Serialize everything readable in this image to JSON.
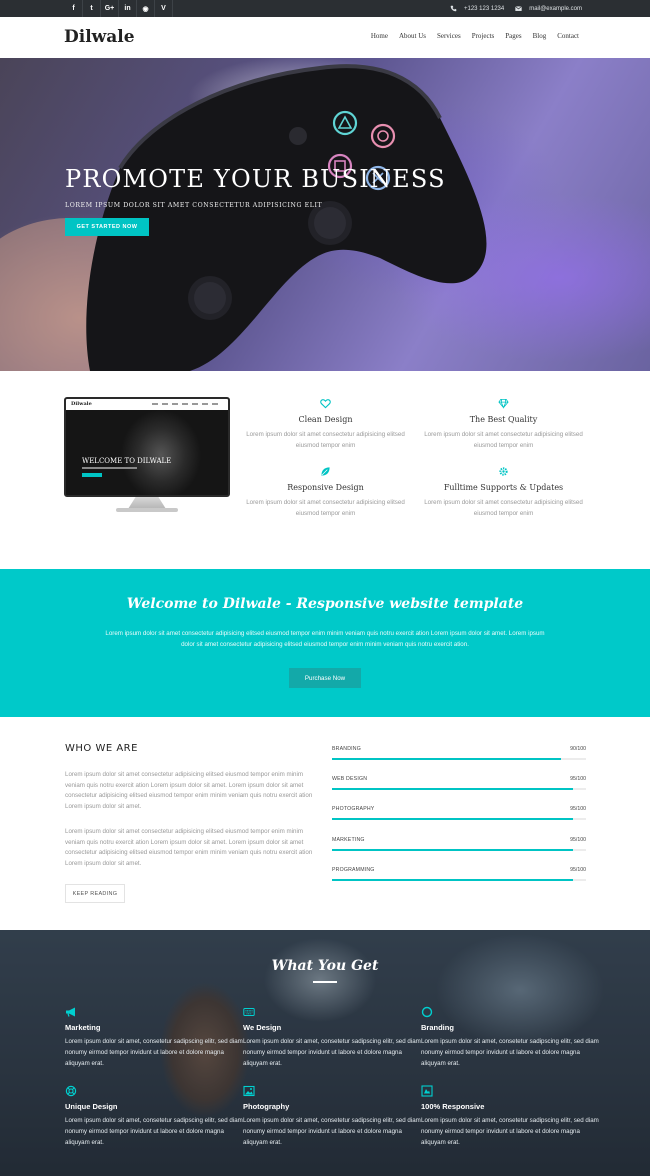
{
  "topbar": {
    "social": [
      {
        "icon": "facebook-icon",
        "glyph": "f"
      },
      {
        "icon": "twitter-icon",
        "glyph": "t"
      },
      {
        "icon": "google-plus-icon",
        "glyph": "G+"
      },
      {
        "icon": "linkedin-icon",
        "glyph": "in"
      },
      {
        "icon": "dribbble-icon",
        "glyph": "◉"
      },
      {
        "icon": "vimeo-icon",
        "glyph": "V"
      }
    ],
    "phone": "+123 123 1234",
    "email": "mail@example.com"
  },
  "nav": {
    "logo": "Dilwale",
    "items": [
      "Home",
      "About Us",
      "Services",
      "Projects",
      "Pages",
      "Blog",
      "Contact"
    ]
  },
  "hero": {
    "title": "PROMOTE YOUR BUSINESS",
    "subtitle": "LOREM IPSUM DOLOR SIT AMET CONSECTETUR ADIPISICING ELIT",
    "button": "GET STARTED NOW"
  },
  "monitor": {
    "logo": "Dilwale",
    "title": "WELCOME TO DILWALE"
  },
  "features": [
    {
      "icon": "heart-icon",
      "title": "Clean Design",
      "text": "Lorem ipsum dolor sit amet consectetur adipisicing elitsed eiusmod tempor enim"
    },
    {
      "icon": "diamond-icon",
      "title": "The Best Quality",
      "text": "Lorem ipsum dolor sit amet consectetur adipisicing elitsed eiusmod tempor enim"
    },
    {
      "icon": "leaf-icon",
      "title": "Responsive Design",
      "text": "Lorem ipsum dolor sit amet consectetur adipisicing elitsed eiusmod tempor enim"
    },
    {
      "icon": "gear-icon",
      "title": "Fulltime Supports & Updates",
      "text": "Lorem ipsum dolor sit amet consectetur adipisicing elitsed eiusmod tempor enim"
    }
  ],
  "welcome": {
    "title": "Welcome to Dilwale - Responsive website template",
    "text": "Lorem ipsum dolor sit amet consectetur adipisicing elitsed eiusmod tempor enim minim veniam quis notru exercit ation Lorem ipsum dolor sit amet. Lorem ipsum dolor sit amet consectetur adipisicing elitsed eiusmod tempor enim minim veniam quis notru exercit ation.",
    "button": "Purchase Now"
  },
  "who": {
    "title": "WHO WE ARE",
    "para1": "Lorem ipsum dolor sit amet consectetur adipisicing elitsed eiusmod tempor enim minim veniam quis notru exercit ation Lorem ipsum dolor sit amet. Lorem ipsum dolor sit amet consectetur adipisicing elitsed eiusmod tempor enim minim veniam quis notru exercit ation Lorem ipsum dolor sit amet.",
    "para2": "Lorem ipsum dolor sit amet consectetur adipisicing elitsed eiusmod tempor enim minim veniam quis notru exercit ation Lorem ipsum dolor sit amet. Lorem ipsum dolor sit amet consectetur adipisicing elitsed eiusmod tempor enim minim veniam quis notru exercit ation Lorem ipsum dolor sit amet.",
    "button": "KEEP READING"
  },
  "skills": [
    {
      "name": "BRANDING",
      "value": "90/100",
      "percent": 90
    },
    {
      "name": "WEB DESIGN",
      "value": "95/100",
      "percent": 95
    },
    {
      "name": "PHOTOGRAPHY",
      "value": "95/100",
      "percent": 95
    },
    {
      "name": "MARKETING",
      "value": "95/100",
      "percent": 95
    },
    {
      "name": "PROGRAMMING",
      "value": "95/100",
      "percent": 95
    }
  ],
  "get": {
    "title": "What You Get",
    "services": [
      {
        "icon": "megaphone-icon",
        "title": "Marketing",
        "text": "Lorem ipsum dolor sit amet, consetetur sadipscing elitr, sed diam nonumy eirmod tempor invidunt ut labore et dolore magna aliquyam erat."
      },
      {
        "icon": "keyboard-icon",
        "title": "We Design",
        "text": "Lorem ipsum dolor sit amet, consetetur sadipscing elitr, sed diam nonumy eirmod tempor invidunt ut labore et dolore magna aliquyam erat."
      },
      {
        "icon": "circle-icon",
        "title": "Branding",
        "text": "Lorem ipsum dolor sit amet, consetetur sadipscing elitr, sed diam nonumy eirmod tempor invidunt ut labore et dolore magna aliquyam erat."
      },
      {
        "icon": "life-ring-icon",
        "title": "Unique Design",
        "text": "Lorem ipsum dolor sit amet, consetetur sadipscing elitr, sed diam nonumy eirmod tempor invidunt ut labore et dolore magna aliquyam erat."
      },
      {
        "icon": "image-icon",
        "title": "Photography",
        "text": "Lorem ipsum dolor sit amet, consetetur sadipscing elitr, sed diam nonumy eirmod tempor invidunt ut labore et dolore magna aliquyam erat."
      },
      {
        "icon": "responsive-icon",
        "title": "100% Responsive",
        "text": "Lorem ipsum dolor sit amet, consetetur sadipscing elitr, sed diam nonumy eirmod tempor invidunt ut labore et dolore magna aliquyam erat."
      }
    ]
  },
  "colors": {
    "accent": "#00c9c9",
    "topbar": "#2b2f33",
    "button_dark": "#13a9a9"
  }
}
